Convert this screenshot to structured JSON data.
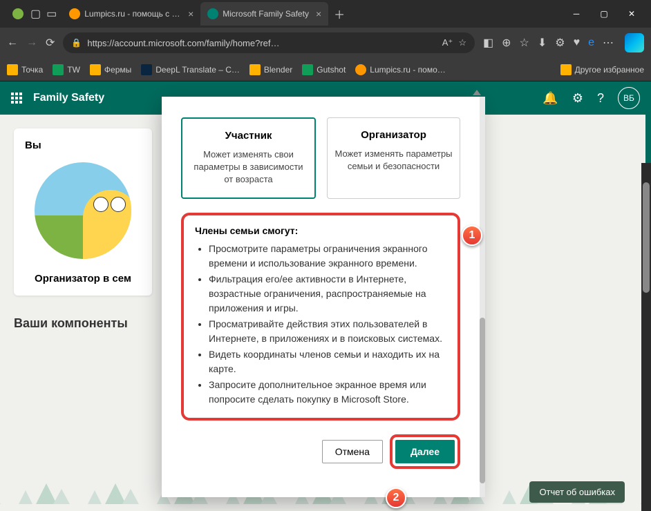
{
  "tabs": [
    {
      "label": "",
      "icon_bg": "#7cb342"
    },
    {
      "label": "Lumpics.ru - помощь с компьют",
      "icon_bg": "#ff9800"
    },
    {
      "label": "Microsoft Family Safety",
      "icon_bg": "#008272",
      "active": true
    }
  ],
  "url": "https://account.microsoft.com/family/home?ref…",
  "bookmarks": [
    {
      "label": "Точка",
      "color": "#ffb300"
    },
    {
      "label": "TW",
      "color": "#0f9d58"
    },
    {
      "label": "Фермы",
      "color": "#ffb300"
    },
    {
      "label": "DeepL Translate – С…",
      "color": "#0a2540"
    },
    {
      "label": "Blender",
      "color": "#ffb300"
    },
    {
      "label": "Gutshot",
      "color": "#0f9d58"
    },
    {
      "label": "Lumpics.ru - помо…",
      "color": "#ff9800"
    }
  ],
  "bookmarks_other": "Другое избранное",
  "app": {
    "title": "Family Safety",
    "avatar": "ВБ"
  },
  "card": {
    "you": "Вы",
    "role": "Организатор в сем"
  },
  "subhead": "Ваши компоненты",
  "report_btn": "Отчет об ошибках",
  "modal": {
    "roles": [
      {
        "title": "Участник",
        "desc": "Может изменять свои параметры в зависимости от возраста",
        "selected": true
      },
      {
        "title": "Организатор",
        "desc": "Может изменять параметры семьи и безопасности",
        "selected": false
      }
    ],
    "info_title": "Члены семьи смогут:",
    "info_items": [
      "Просмотрите параметры ограничения экранного времени и использование экранного времени.",
      "Фильтрация его/ее активности в Интернете, возрастные ограничения, распространяемые на приложения и игры.",
      "Просматривайте действия этих пользователей в Интернете, в приложениях и в поисковых системах.",
      "Видеть координаты членов семьи и находить их на карте.",
      "Запросите дополнительное экранное время или попросите сделать покупку в Microsoft Store."
    ],
    "cancel": "Отмена",
    "next": "Далее"
  },
  "callouts": {
    "c1": "1",
    "c2": "2"
  }
}
